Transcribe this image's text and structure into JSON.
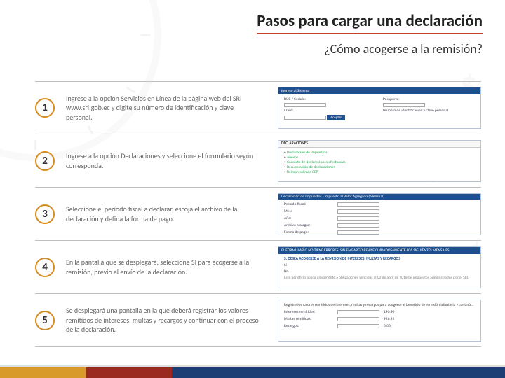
{
  "header": {
    "title": "Pasos para cargar una declaración",
    "subtitle": "¿Cómo acogerse a la remisión?"
  },
  "steps": [
    {
      "num": "1",
      "text": "Ingrese a la opción Servicios en Línea de la página web del SRI www.sri.gob.ec y digite su número de identificación y clave personal.",
      "thumb": {
        "bar": "Ingreso al Sistema",
        "left": [
          "RUC / Cédula:",
          "Clave:"
        ],
        "right": [
          "Pasaporte:",
          "Número de identificación y clave personal"
        ],
        "actions": [
          "Aceptar"
        ]
      }
    },
    {
      "num": "2",
      "text": "Ingrese a la opción Declaraciones y seleccione el formulario según corresponda.",
      "thumb": {
        "bar": "",
        "title": "DECLARACIONES",
        "list": [
          "Declaración de impuestos",
          "Anexos",
          "Consulta de declaraciones efectuadas",
          "Recuperación de declaraciones",
          "Reimpresión de CEP"
        ]
      }
    },
    {
      "num": "3",
      "text": "Seleccione el período fiscal a declarar, escoja el archivo de la declaración y defina la forma de pago.",
      "thumb": {
        "bar": "Declaración de Impuestos - Impuesto al Valor Agregado (Mensual)",
        "rows": [
          "Período fiscal:",
          "Mes:",
          "Año:",
          "Archivo a cargar:",
          "Forma de pago:"
        ]
      }
    },
    {
      "num": "4",
      "text": "En la pantalla que se desplegará, seleccione SI para acogerse a la remisión, previo al envío de la declaración.",
      "thumb": {
        "bar": "EL FORMULARIO NO TIENE ERRORES. SIN EMBARGO REVISE CUIDADOSAMENTE LOS SIGUIENTES MENSAJES",
        "sub": "S: DESEA ACOGERSE A LA REMISIÓN DE INTERESES, MULTAS Y RECARGOS",
        "options": [
          "Sí",
          "No"
        ],
        "note": "Este beneficio aplica únicamente a obligaciones vencidas al 02 de abril de 2018 de impuestos administrados por el SRI."
      }
    },
    {
      "num": "5",
      "text": "Se desplegará una pantalla en la que deberá registrar los valores remitidos de intereses, multas y recargos y continuar con el proceso de la declaración.",
      "thumb": {
        "bar": "",
        "lead": "Registre los valores remitidos de intereses, multas y recargos para acogerse al beneficio de remisión tributaria y continúe con el proceso.",
        "rows": [
          "Intereses remitidos:",
          "Multas remitidas:",
          "Recargos:"
        ],
        "vals": [
          "190.40",
          "926.42",
          "0.00"
        ]
      }
    }
  ]
}
